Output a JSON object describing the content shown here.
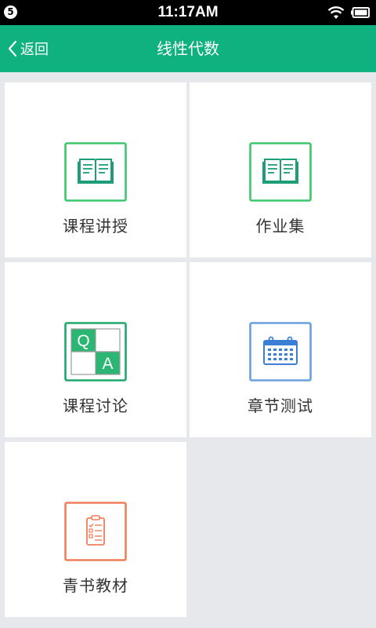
{
  "status_bar": {
    "notification_count": "5",
    "time": "11:17AM",
    "icons": [
      "wifi-icon",
      "battery-icon"
    ]
  },
  "header": {
    "back_label": "返回",
    "title": "线性代数",
    "background_color": "#0fb27f"
  },
  "tiles": [
    {
      "label": "课程讲授",
      "icon": "book-icon",
      "color": "#3cc76c"
    },
    {
      "label": "作业集",
      "icon": "book-icon",
      "color": "#3cc76c"
    },
    {
      "label": "课程讨论",
      "icon": "qa-icon",
      "color": "#1ea86a",
      "qa_q": "Q",
      "qa_a": "A"
    },
    {
      "label": "章节测试",
      "icon": "calendar-icon",
      "color": "#6a9fe0"
    },
    {
      "label": "青书教材",
      "icon": "clipboard-icon",
      "color": "#ef7f5b"
    }
  ]
}
